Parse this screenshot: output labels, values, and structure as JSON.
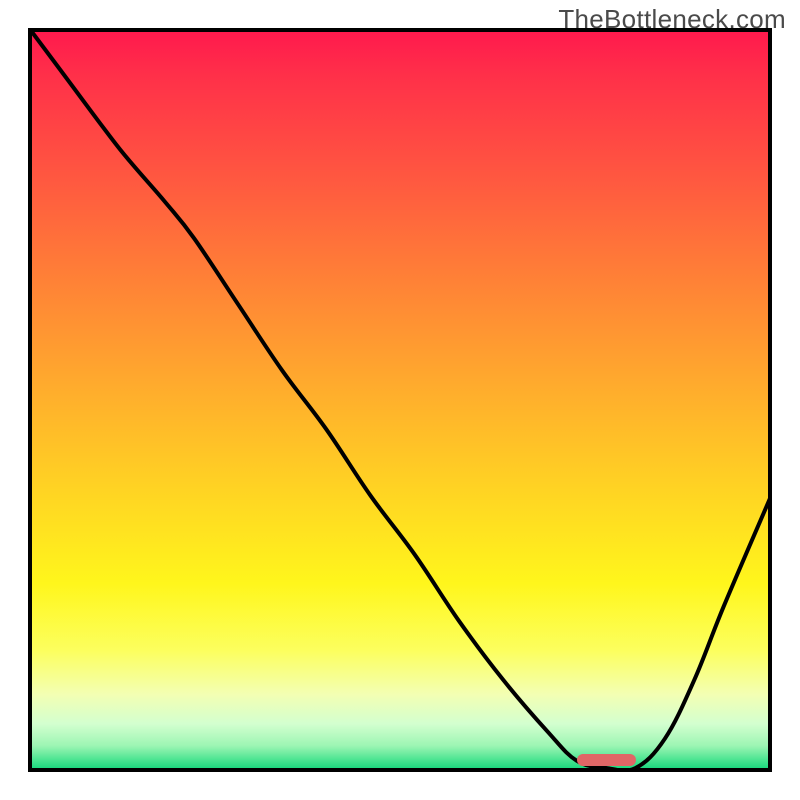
{
  "watermark": "TheBottleneck.com",
  "colors": {
    "curve_stroke": "#000000",
    "marker_fill": "#e06666",
    "border": "#000000"
  },
  "chart_data": {
    "type": "line",
    "title": "",
    "xlabel": "",
    "ylabel": "",
    "xlim": [
      0,
      100
    ],
    "ylim": [
      0,
      100
    ],
    "grid": false,
    "legend": false,
    "annotations": [
      {
        "text": "TheBottleneck.com",
        "pos": "top-right"
      }
    ],
    "series": [
      {
        "name": "bottleneck-curve",
        "x": [
          0,
          6,
          12,
          18,
          22,
          28,
          34,
          40,
          46,
          52,
          58,
          64,
          70,
          74,
          78,
          82,
          86,
          90,
          94,
          100
        ],
        "y": [
          100,
          92,
          84,
          77,
          72,
          63,
          54,
          46,
          37,
          29,
          20,
          12,
          5,
          1,
          0,
          0,
          4,
          12,
          22,
          36
        ]
      }
    ],
    "optimal_range": {
      "x_start": 74,
      "x_end": 82,
      "y": 0
    },
    "background_gradient": {
      "top": "#ff1a4d",
      "mid": "#ffd323",
      "bottom": "#1ed87f"
    }
  }
}
